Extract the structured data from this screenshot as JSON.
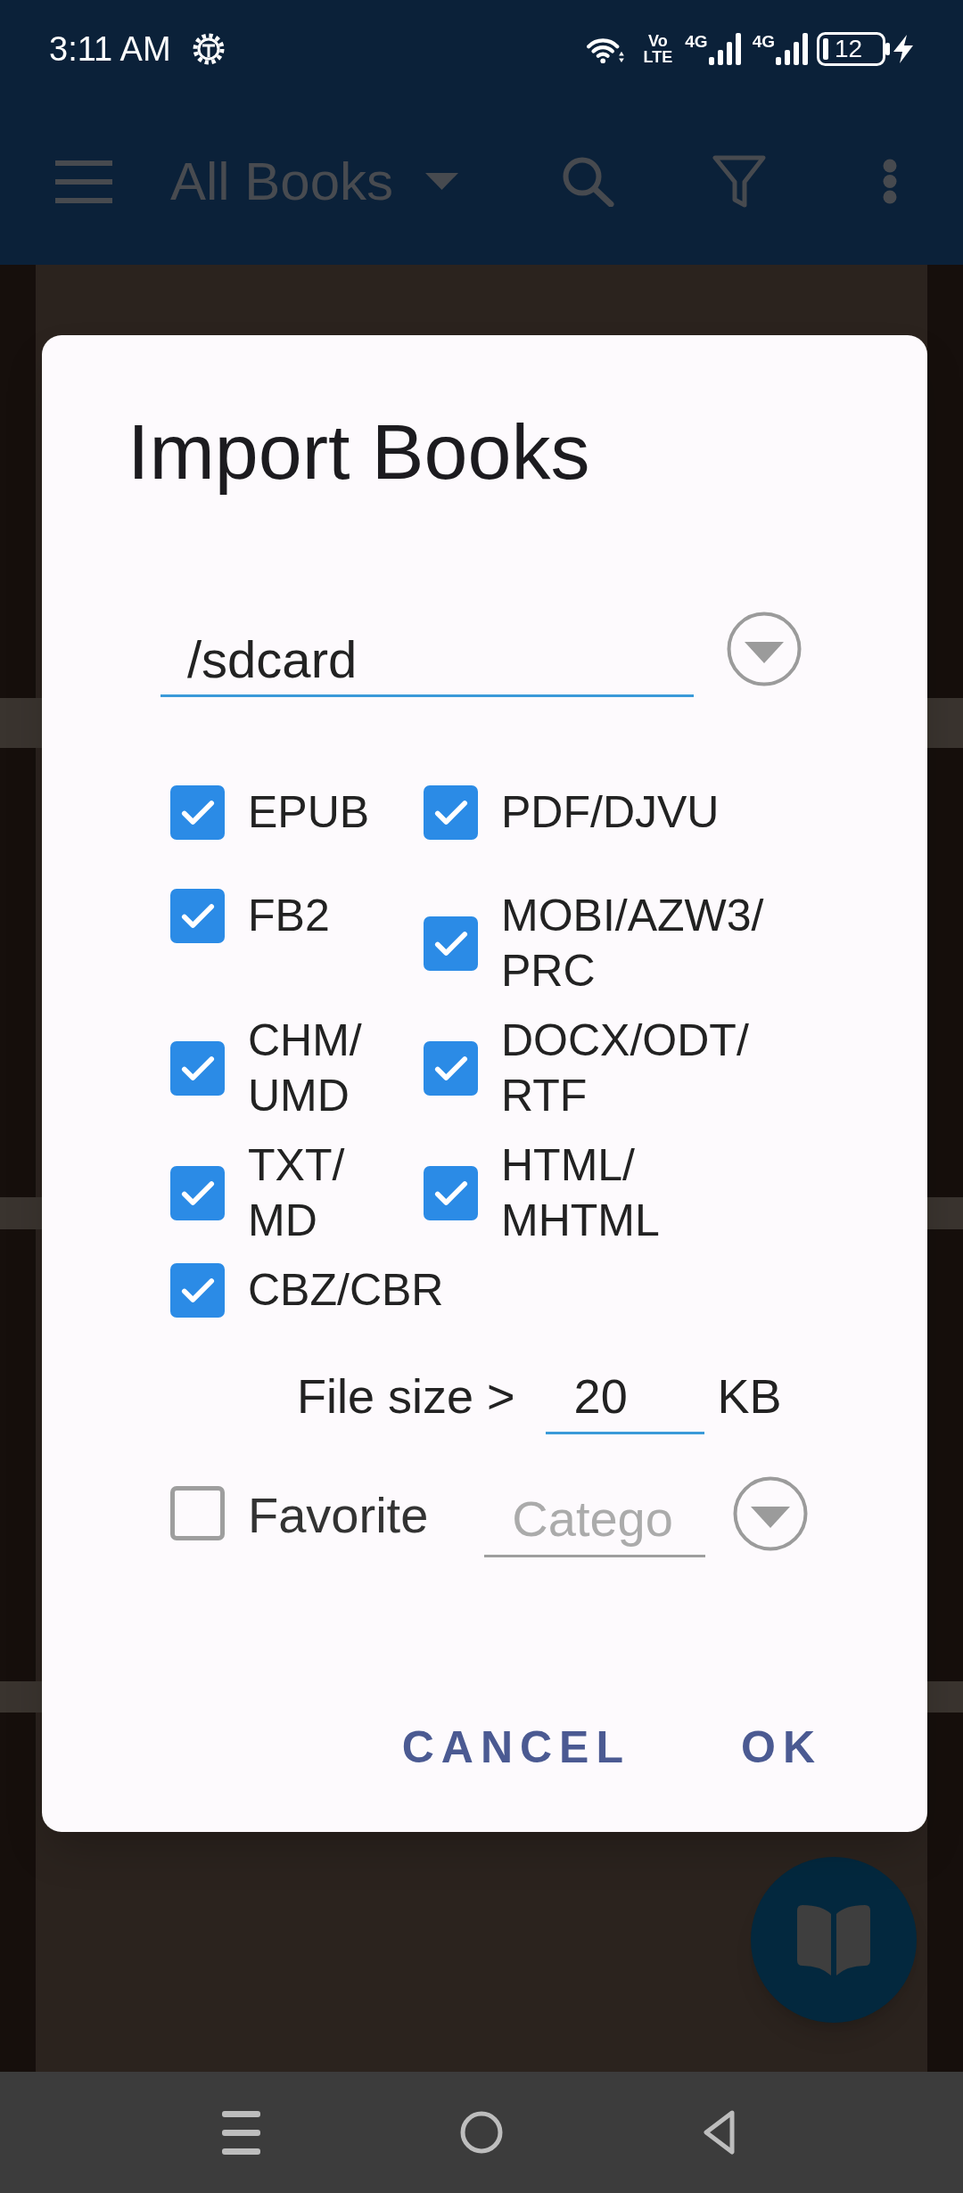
{
  "status_bar": {
    "time": "3:11 AM",
    "volte": [
      "Vo",
      "LTE"
    ],
    "signals": [
      {
        "network": "4G"
      },
      {
        "network": "4G"
      }
    ],
    "battery": "12"
  },
  "app_bar": {
    "title": "All Books"
  },
  "dialog": {
    "title": "Import Books",
    "folder": {
      "value": "/sdcard"
    },
    "formats": [
      {
        "label": "EPUB",
        "checked": true
      },
      {
        "label": "PDF/DJVU",
        "checked": true
      },
      {
        "label": "FB2",
        "checked": true
      },
      {
        "label": "MOBI/AZW3/PRC",
        "checked": true
      },
      {
        "label": "CHM/UMD",
        "checked": true
      },
      {
        "label": "DOCX/ODT/RTF",
        "checked": true
      },
      {
        "label": "TXT/MD",
        "checked": true
      },
      {
        "label": "HTML/MHTML",
        "checked": true
      },
      {
        "label": "CBZ/CBR",
        "checked": true
      }
    ],
    "file_size": {
      "label": "File size >",
      "value": "20",
      "unit": "KB"
    },
    "favorite": {
      "label": "Favorite",
      "checked": false
    },
    "category": {
      "placeholder": "Catego"
    },
    "buttons": [
      "CANCEL",
      "OK"
    ]
  }
}
